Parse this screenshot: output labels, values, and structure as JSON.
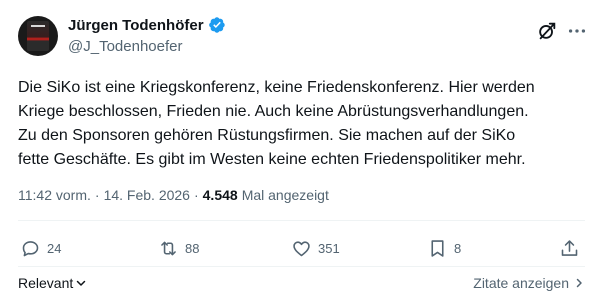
{
  "author": {
    "display_name": "Jürgen Todenhöfer",
    "handle": "@J_Todenhoefer"
  },
  "tweet": {
    "lines": [
      "Die SiKo ist eine Kriegskonferenz, keine Friedenskonferenz. Hier werden",
      "Kriege beschlossen, Frieden nie. Auch keine Abrüstungsverhandlungen.",
      "Zu den Sponsoren gehören Rüstungsfirmen. Sie machen auf der SiKo",
      "fette Geschäfte. Es gibt im Westen keine echten Friedenspolitiker mehr."
    ]
  },
  "meta": {
    "time": "11:42 vorm.",
    "sep1": "·",
    "date": "14. Feb. 2026",
    "sep2": "·",
    "views": "4.548",
    "views_label": "Mal angezeigt"
  },
  "actions": {
    "replies": "24",
    "reposts": "88",
    "likes": "351",
    "bookmarks": "8"
  },
  "footer": {
    "sort_label": "Relevant",
    "quotes_label": "Zitate anzeigen"
  },
  "colors": {
    "verified": "#1d9bf0",
    "text": "#0f1419",
    "secondary": "#536471"
  },
  "icons": [
    "verified-badge-icon",
    "grok-icon",
    "more-icon",
    "reply-icon",
    "repost-icon",
    "like-icon",
    "bookmark-icon",
    "share-icon",
    "chevron-down-icon",
    "chevron-right-icon"
  ]
}
